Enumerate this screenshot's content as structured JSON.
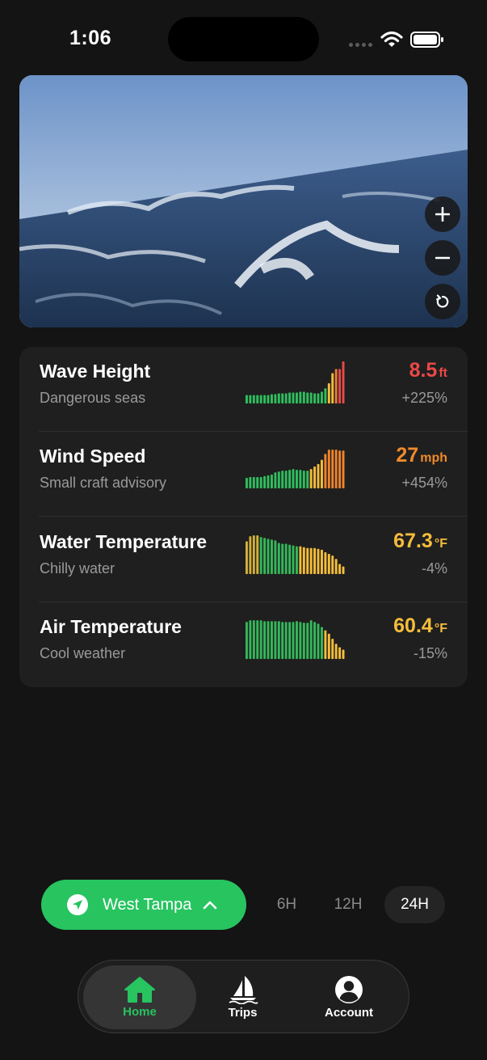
{
  "status_bar": {
    "time": "1:06"
  },
  "camera": {
    "controls": [
      {
        "name": "zoom-in",
        "icon": "plus-icon"
      },
      {
        "name": "zoom-out",
        "icon": "minus-icon"
      },
      {
        "name": "refresh",
        "icon": "rotate-icon"
      }
    ]
  },
  "colors": {
    "green": "#27c460",
    "danger": "#ea4848",
    "warning": "#f08a2a",
    "caution": "#f5bd3a",
    "muted": "#9a9a9a"
  },
  "metrics": [
    {
      "title": "Wave Height",
      "subtitle": "Dangerous seas",
      "value": "8.5",
      "unit": "ft",
      "change": "+225%",
      "color": "#ea4848",
      "bars": [
        0.2,
        0.2,
        0.2,
        0.2,
        0.2,
        0.2,
        0.2,
        0.22,
        0.22,
        0.24,
        0.24,
        0.24,
        0.26,
        0.26,
        0.26,
        0.28,
        0.28,
        0.26,
        0.26,
        0.24,
        0.24,
        0.28,
        0.36,
        0.48,
        0.72,
        0.82,
        0.82,
        1.0
      ]
    },
    {
      "title": "Wind Speed",
      "subtitle": "Small craft advisory",
      "value": "27",
      "unit": "mph",
      "change": "+454%",
      "color": "#f08a2a",
      "bars": [
        0.25,
        0.27,
        0.27,
        0.27,
        0.27,
        0.29,
        0.31,
        0.33,
        0.38,
        0.4,
        0.42,
        0.42,
        0.44,
        0.46,
        0.44,
        0.44,
        0.42,
        0.42,
        0.46,
        0.52,
        0.58,
        0.68,
        0.82,
        0.92,
        0.92,
        0.92,
        0.9,
        0.9
      ]
    },
    {
      "title": "Water Temperature",
      "subtitle": "Chilly water",
      "value": "67.3",
      "unit": "°F",
      "change": "-4%",
      "color": "#f5bd3a",
      "bars": [
        0.78,
        0.9,
        0.92,
        0.92,
        0.88,
        0.86,
        0.84,
        0.82,
        0.8,
        0.74,
        0.72,
        0.72,
        0.7,
        0.68,
        0.66,
        0.66,
        0.64,
        0.62,
        0.62,
        0.62,
        0.6,
        0.58,
        0.52,
        0.48,
        0.44,
        0.36,
        0.24,
        0.18
      ]
    },
    {
      "title": "Air Temperature",
      "subtitle": "Cool weather",
      "value": "60.4",
      "unit": "°F",
      "change": "-15%",
      "color": "#f5bd3a",
      "bars": [
        0.88,
        0.92,
        0.92,
        0.92,
        0.92,
        0.9,
        0.9,
        0.9,
        0.9,
        0.9,
        0.88,
        0.88,
        0.88,
        0.88,
        0.9,
        0.88,
        0.86,
        0.86,
        0.92,
        0.88,
        0.84,
        0.76,
        0.68,
        0.6,
        0.48,
        0.36,
        0.28,
        0.22
      ]
    }
  ],
  "location": {
    "label": "West Tampa",
    "icon": "location-arrow-icon"
  },
  "ranges": [
    {
      "label": "6H",
      "active": false
    },
    {
      "label": "12H",
      "active": false
    },
    {
      "label": "24H",
      "active": true
    }
  ],
  "tabs": [
    {
      "label": "Home",
      "icon": "home-icon",
      "active": true
    },
    {
      "label": "Trips",
      "icon": "sailboat-icon",
      "active": false
    },
    {
      "label": "Account",
      "icon": "account-icon",
      "active": false
    }
  ]
}
